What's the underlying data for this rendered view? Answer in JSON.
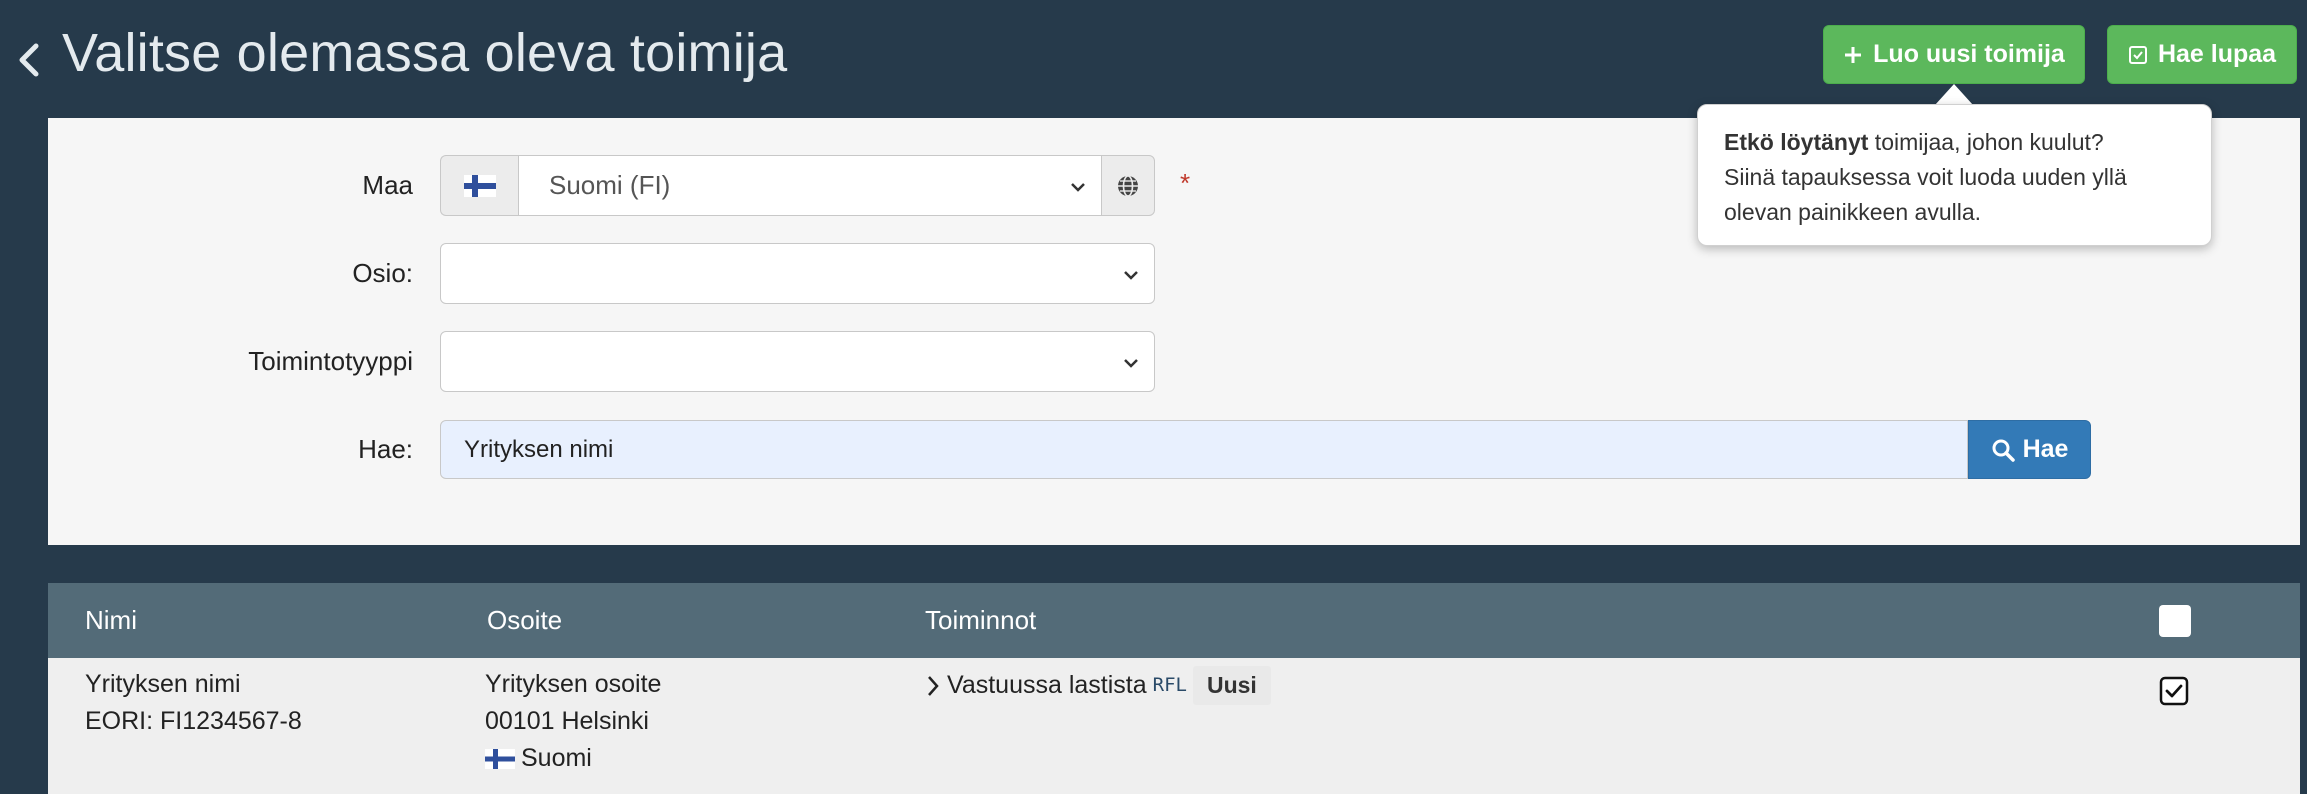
{
  "header": {
    "title": "Valitse olemassa oleva toimija",
    "create_button_label": "Luo uusi toimija",
    "permit_button_label": "Hae lupaa",
    "back_icon": "chevron-left-icon"
  },
  "tooltip": {
    "bold_text": "Etkö löytänyt",
    "text_line1": " toimijaa, johon kuulut?",
    "text_line2": "Siinä tapauksessa voit luoda uuden yllä",
    "text_line3": "olevan painikkeen avulla."
  },
  "form": {
    "country_label": "Maa",
    "country_value": "Suomi (FI)",
    "required_marker": "*",
    "section_label": "Osio:",
    "section_value": "",
    "activity_type_label": "Toimintotyyppi",
    "activity_type_value": "",
    "search_label": "Hae:",
    "search_value": "Yrityksen nimi",
    "search_button_label": "Hae"
  },
  "table": {
    "columns": [
      "Nimi",
      "Osoite",
      "Toiminnot"
    ],
    "rows": [
      {
        "name": "Yrityksen nimi",
        "eori": "EORI: FI1234567-8",
        "address_line1": "Yrityksen osoite",
        "address_line2": "00101 Helsinki",
        "country": "Suomi",
        "activity": "Vastuussa lastista",
        "activity_code": "RFL",
        "badge": "Uusi",
        "selected": true
      }
    ]
  },
  "colors": {
    "background": "#263a4b",
    "green": "#5cb85c",
    "blue": "#337ab7",
    "table_header": "#536b78"
  }
}
